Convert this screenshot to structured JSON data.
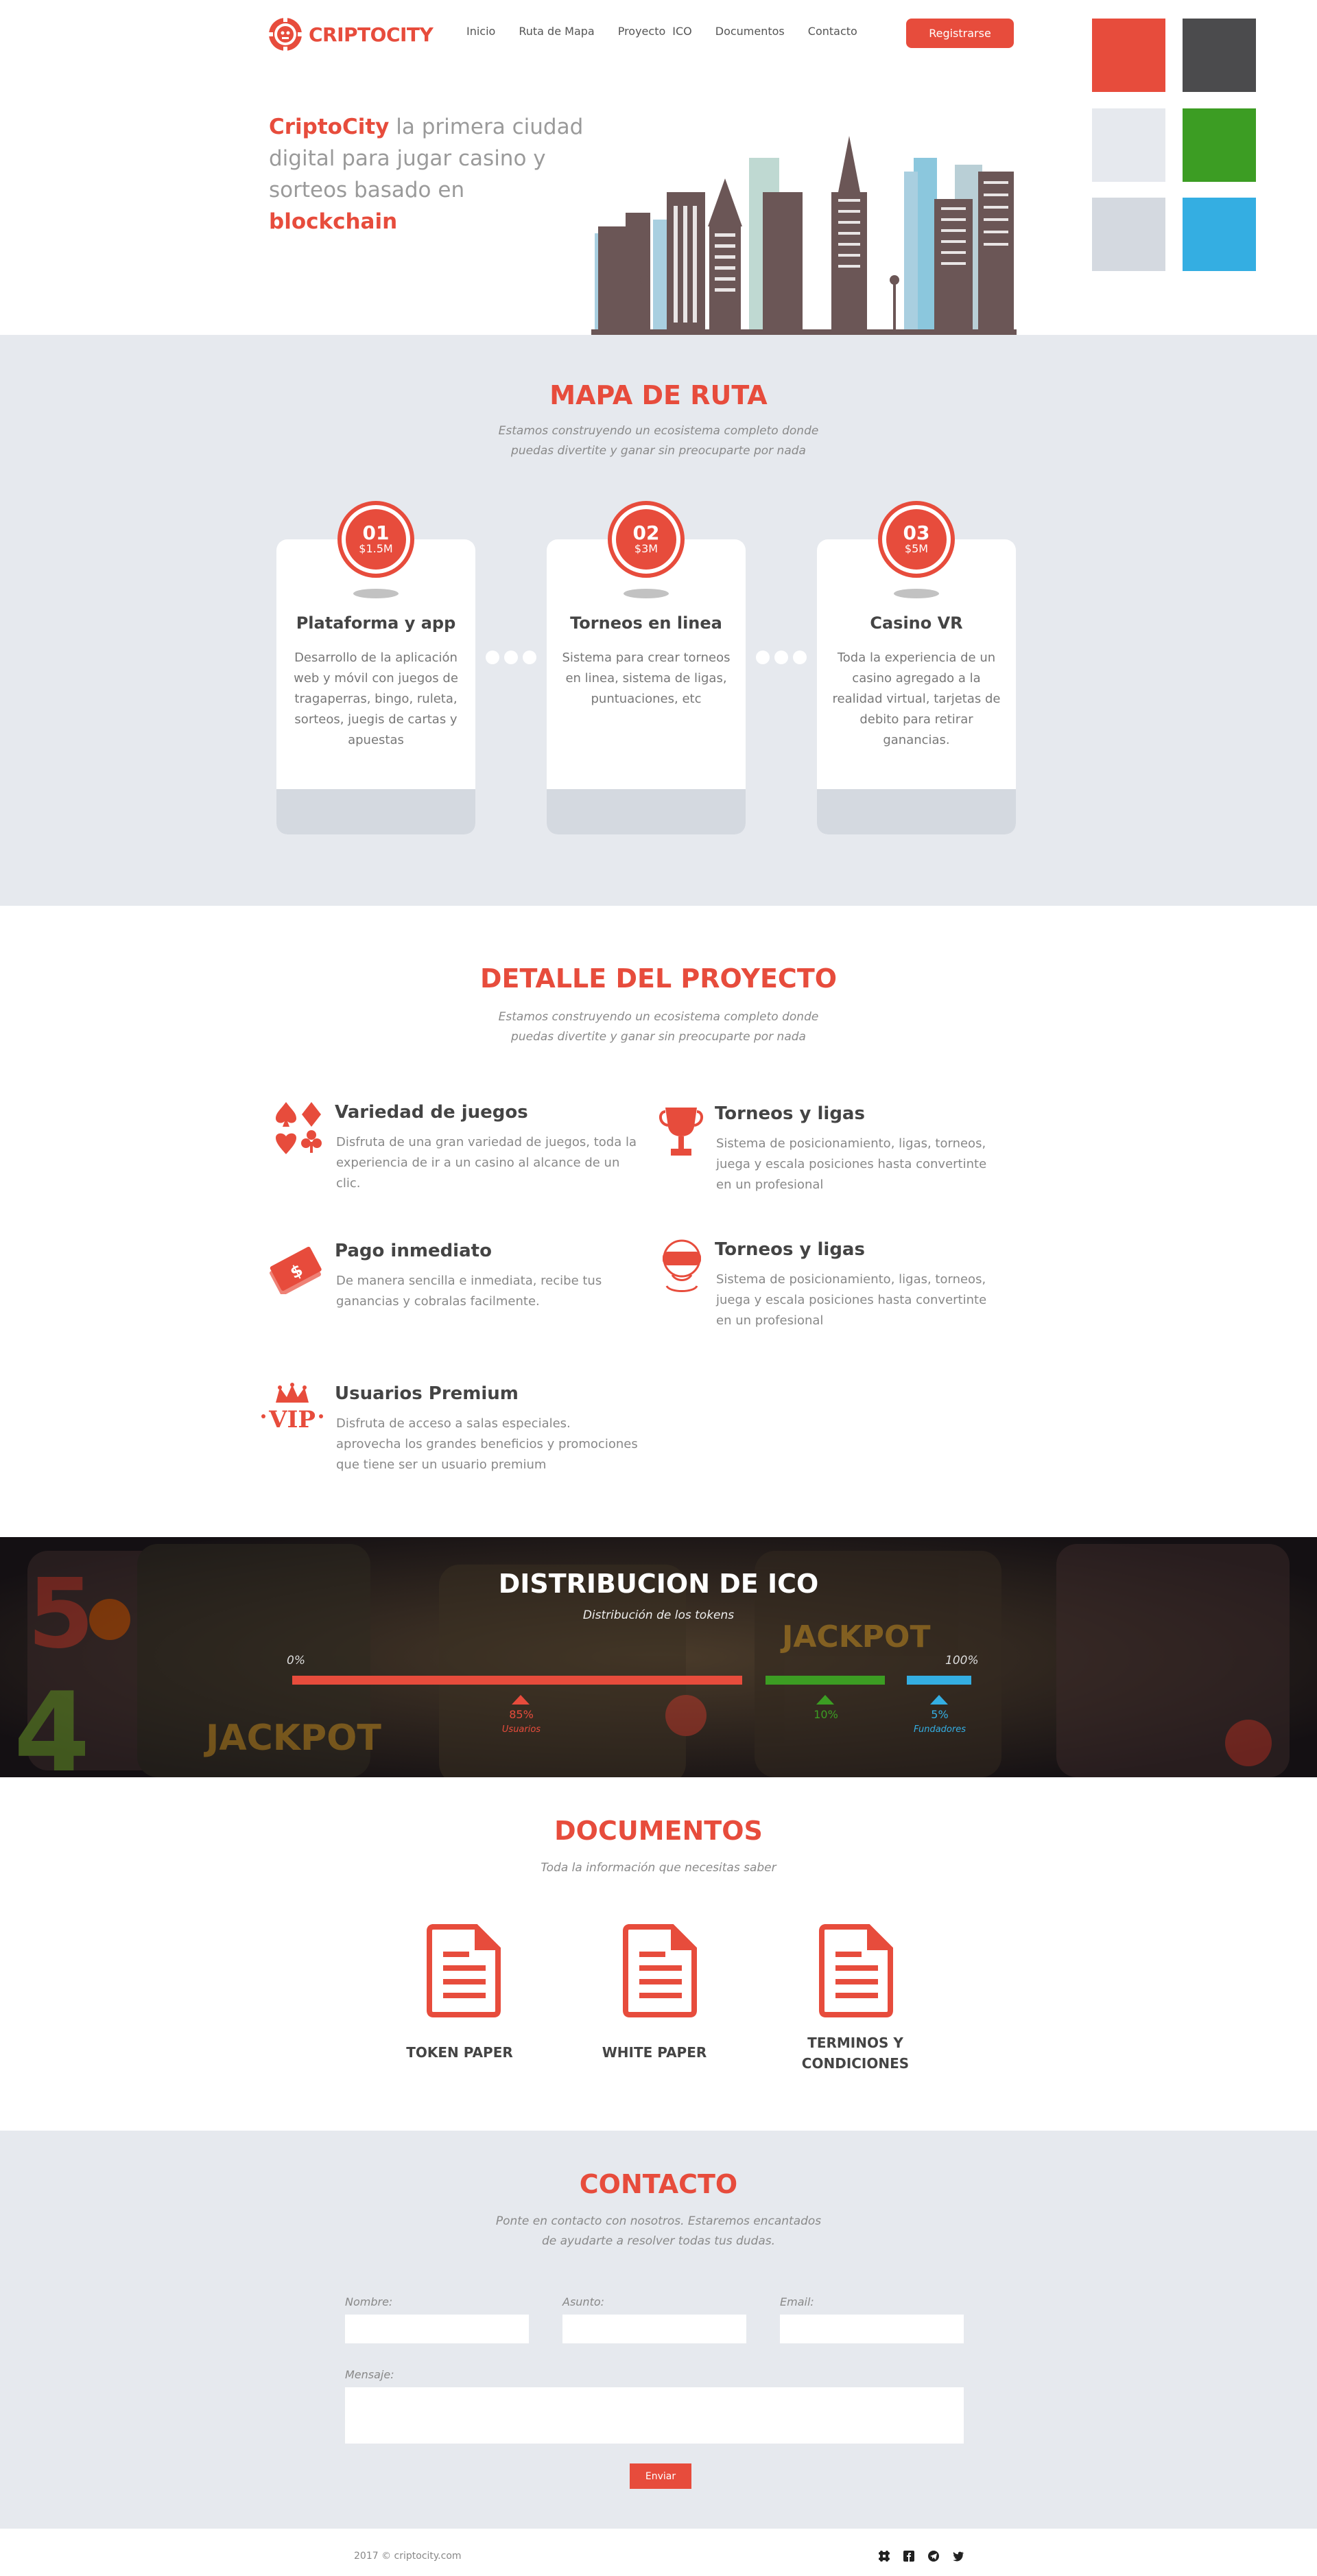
{
  "header": {
    "logo_text": "CRIPTOCITY",
    "nav": [
      "Inicio",
      "Ruta de Mapa",
      "Proyecto",
      "ICO",
      "Documentos",
      "Contacto"
    ],
    "register_label": "Registrarse"
  },
  "palette": [
    "#e74c3c",
    "#4b4b4d",
    "#e6e9ee",
    "#3c9d23",
    "#d4d9e0",
    "#34aee2"
  ],
  "hero": {
    "brand": "CriptoCity",
    "text_1": " la primera ciudad digital para jugar casino y sorteos basado en ",
    "highlight": "blockchain"
  },
  "roadmap": {
    "title": "MAPA DE RUTA",
    "subtitle_1": "Estamos construyendo un ecosistema completo donde",
    "subtitle_2": "puedas divertite y ganar sin preocuparte por nada",
    "items": [
      {
        "num": "01",
        "amount": "$1.5M",
        "title": "Plataforma y app",
        "desc": "Desarrollo de la aplicación web y móvil con juegos de tragaperras, bingo, ruleta, sorteos, juegis de cartas y apuestas"
      },
      {
        "num": "02",
        "amount": "$3M",
        "title": "Torneos en linea",
        "desc": "Sistema para crear torneos en linea, sistema de ligas, puntuaciones, etc"
      },
      {
        "num": "03",
        "amount": "$5M",
        "title": "Casino VR",
        "desc": "Toda la experiencia de un casino agregado a la realidad virtual, tarjetas de debito para retirar ganancias."
      }
    ]
  },
  "project": {
    "title": "DETALLE DEL PROYECTO",
    "subtitle_1": "Estamos construyendo un ecosistema completo donde",
    "subtitle_2": "puedas divertite y ganar sin preocuparte por nada",
    "features": [
      {
        "icon": "card-suits-icon",
        "title": "Variedad de juegos",
        "desc": "Disfruta de una gran variedad de juegos, toda la experiencia de ir a un casino al alcance de un clic."
      },
      {
        "icon": "trophy-icon",
        "title": "Torneos y ligas",
        "desc": "Sistema de posicionamiento, ligas, torneos, juega y escala posiciones hasta convertinte en un profesional"
      },
      {
        "icon": "money-icon",
        "title": "Pago inmediato",
        "desc": "De manera sencilla e inmediata, recibe tus ganancias y cobralas facilmente."
      },
      {
        "icon": "vr-headset-icon",
        "title": "Torneos y ligas",
        "desc": "Sistema de posicionamiento, ligas, torneos, juega y escala posiciones hasta convertinte en un profesional"
      },
      {
        "icon": "vip-crown-icon",
        "title": "Usuarios Premium",
        "desc": "Disfruta de acceso a salas especiales. aprovecha los grandes beneficios y promociones que tiene ser un usuario premium"
      }
    ]
  },
  "ico": {
    "title": "DISTRIBUCION DE ICO",
    "subtitle": "Distribución de los tokens",
    "start_label": "0%",
    "end_label": "100%",
    "segments": [
      {
        "percent": 85,
        "pct_label": "85%",
        "name": "Usuarios",
        "color": "#e74c3c"
      },
      {
        "percent": 10,
        "pct_label": "10%",
        "name": "",
        "color": "#3c9d23"
      },
      {
        "percent": 5,
        "pct_label": "5%",
        "name": "Fundadores",
        "color": "#34aee2"
      }
    ]
  },
  "documents": {
    "title": "DOCUMENTOS",
    "subtitle": "Toda la información que necesitas saber",
    "items": [
      "TOKEN PAPER",
      "WHITE PAPER",
      "TERMINOS Y CONDICIONES"
    ]
  },
  "contact": {
    "title": "CONTACTO",
    "subtitle_1": "Ponte en contacto con nosotros. Estaremos encantados",
    "subtitle_2": "de ayudarte a resolver todas tus dudas.",
    "name_label": "Nombre:",
    "subject_label": "Asunto:",
    "email_label": "Email:",
    "message_label": "Mensaje:",
    "send_label": "Enviar"
  },
  "footer": {
    "copyright": "2017 © criptocity.com",
    "social": [
      "slack-icon",
      "facebook-icon",
      "telegram-icon",
      "twitter-icon"
    ]
  }
}
